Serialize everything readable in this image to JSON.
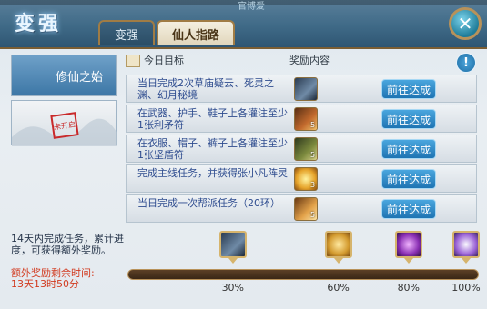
{
  "game_label": "官博爱",
  "title": "变强",
  "tabs": [
    {
      "label": "变强",
      "active": false
    },
    {
      "label": "仙人指路",
      "active": true
    }
  ],
  "left_tabs": [
    {
      "label": "修仙之始",
      "active": true
    },
    {
      "label": "",
      "active": false,
      "stamp": "未开启"
    }
  ],
  "columns": {
    "goal": "今日目标",
    "reward": "奖励内容"
  },
  "tasks": [
    {
      "desc": "当日完成2次草庙疑云、死灵之渊、幻月秘境",
      "reward_icon": "armor-icon",
      "qty": "",
      "button": "前往达成"
    },
    {
      "desc": "在武器、护手、鞋子上各灌注至少1张利矛符",
      "reward_icon": "scroll-icon",
      "qty": "5",
      "button": "前往达成"
    },
    {
      "desc": "在衣服、帽子、裤子上各灌注至少1张坚盾符",
      "reward_icon": "scroll-icon",
      "qty": "5",
      "button": "前往达成"
    },
    {
      "desc": "完成主线任务，并获得张小凡阵灵",
      "reward_icon": "star-icon",
      "qty": "3",
      "button": "前往达成"
    },
    {
      "desc": "当日完成一次帮派任务（20环）",
      "reward_icon": "scroll-icon",
      "qty": "5",
      "button": "前往达成"
    }
  ],
  "bottom": {
    "note": "14天内完成任务，累计进度，可获得额外奖励。",
    "remain_label": "额外奖励剩余时间:",
    "remain_value": "13天13时50分",
    "progress": 0,
    "milestones": [
      {
        "pct_label": "30%",
        "pct": 0.3,
        "icon": "armor-icon"
      },
      {
        "pct_label": "60%",
        "pct": 0.6,
        "icon": "gold-ingot-icon"
      },
      {
        "pct_label": "80%",
        "pct": 0.8,
        "icon": "purple-claw-icon"
      },
      {
        "pct_label": "100%",
        "pct": 1.0,
        "icon": "ring-icon"
      }
    ]
  },
  "colors": {
    "accent_blue": "#1e74b3",
    "task_text": "#2e4c8f",
    "warn_red": "#d23a1f",
    "frame_gold": "#b8925a"
  }
}
